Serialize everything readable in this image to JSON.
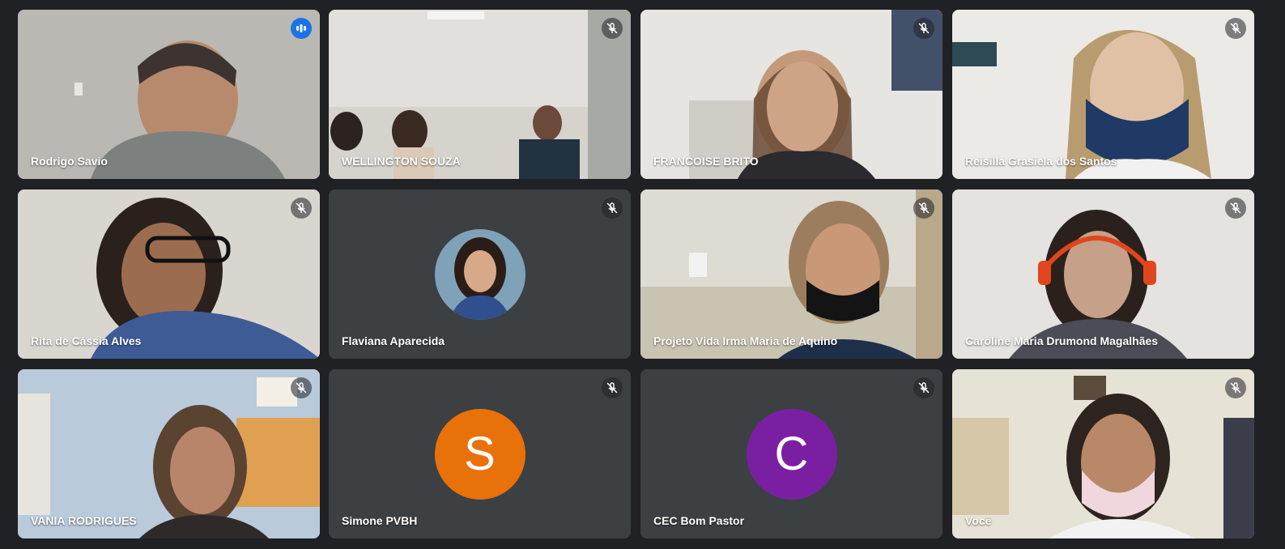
{
  "colors": {
    "background": "#202124",
    "tile": "#3c4043",
    "active_border": "#8ab4f8",
    "speaking_badge": "#1a73e8",
    "avatar_s": "#e8710a",
    "avatar_c": "#7b1fa2"
  },
  "participants": [
    {
      "name": "Rodrigo Savio",
      "state": "speaking",
      "view": "video"
    },
    {
      "name": "WELLINGTON SOUZA",
      "state": "muted",
      "view": "video"
    },
    {
      "name": "FRANCOISE BRITO",
      "state": "muted",
      "view": "video"
    },
    {
      "name": "Reisilla Grasiela dos Santos",
      "state": "muted",
      "view": "video"
    },
    {
      "name": "Rita de Cássia Alves",
      "state": "muted",
      "view": "video"
    },
    {
      "name": "Flaviana Aparecida",
      "state": "muted",
      "view": "photo-avatar"
    },
    {
      "name": "Projeto Vida Irma Maria de Aquino",
      "state": "muted",
      "view": "video"
    },
    {
      "name": "Caroline Maria Drumond Magalhães",
      "state": "muted",
      "view": "video"
    },
    {
      "name": "VANIA RODRIGUES",
      "state": "muted",
      "view": "video"
    },
    {
      "name": "Simone PVBH",
      "state": "muted",
      "view": "initial-avatar",
      "initial": "S"
    },
    {
      "name": "CEC Bom Pastor",
      "state": "muted",
      "view": "initial-avatar",
      "initial": "C"
    },
    {
      "name": "Você",
      "state": "muted",
      "view": "video"
    }
  ],
  "icons": {
    "muted": "mic-off-icon",
    "speaking": "audio-level-icon"
  }
}
